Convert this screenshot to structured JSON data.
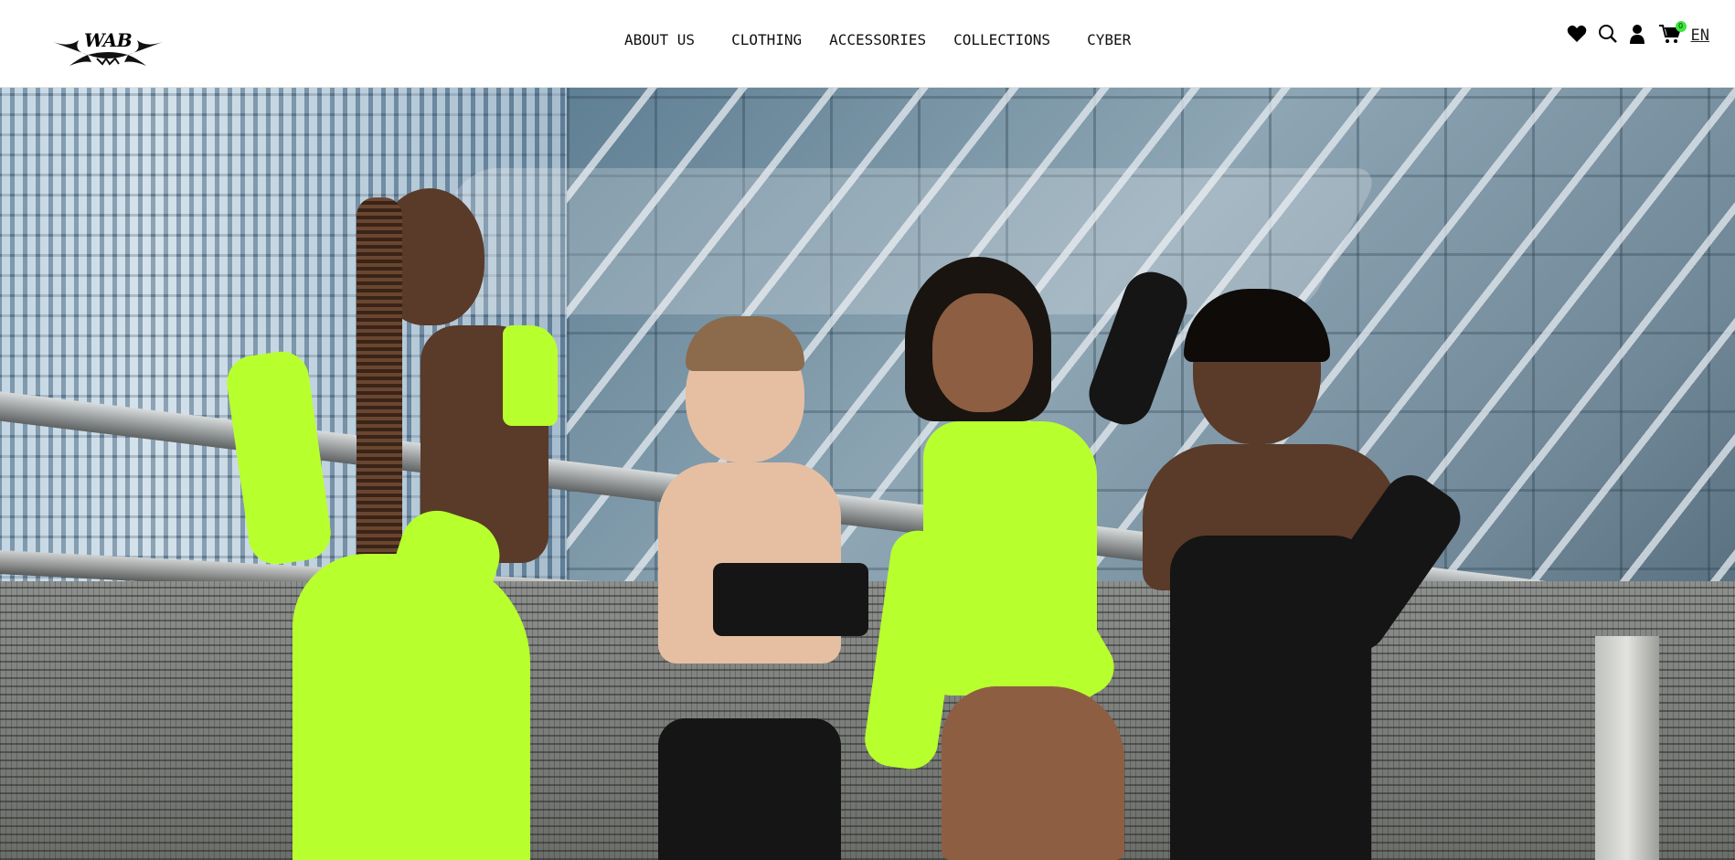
{
  "header": {
    "logo_text": "WAB",
    "nav": {
      "about": "ABOUT US",
      "clothing": "CLOTHING",
      "accessories": "ACCESSORIES",
      "collections": "COLLECTIONS",
      "cyber": "CYBER"
    },
    "icons": [
      "heart-icon",
      "search-icon",
      "user-icon",
      "cart-icon"
    ],
    "cart_count": "0",
    "language": "EN"
  },
  "hero": {
    "image_alt": "",
    "colors": {
      "accent": "#b8ff2e",
      "badge": "#3ee63e"
    }
  }
}
